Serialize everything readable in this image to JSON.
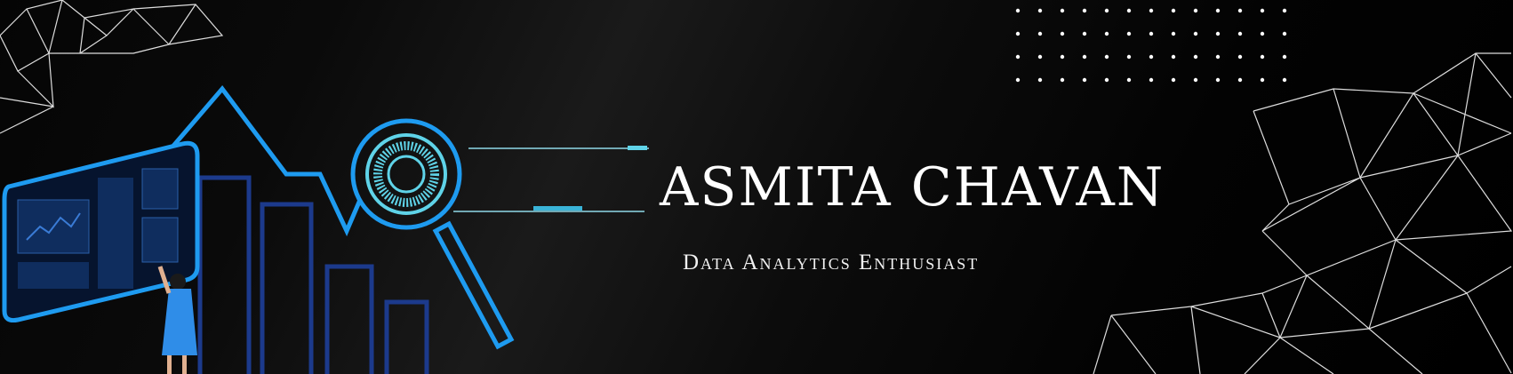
{
  "banner": {
    "title": "ASMITA CHAVAN",
    "subtitle": "Data Analytics Enthusiast"
  },
  "colors": {
    "accent": "#1e9bf0",
    "cyan": "#5fd3e8",
    "navy": "#1c3a8c",
    "background": "#000000"
  },
  "icons": [
    "dashboard-screen-icon",
    "bar-chart-icon",
    "magnifier-icon",
    "woman-figure-icon",
    "polygon-mesh-icon",
    "dot-grid-icon"
  ]
}
